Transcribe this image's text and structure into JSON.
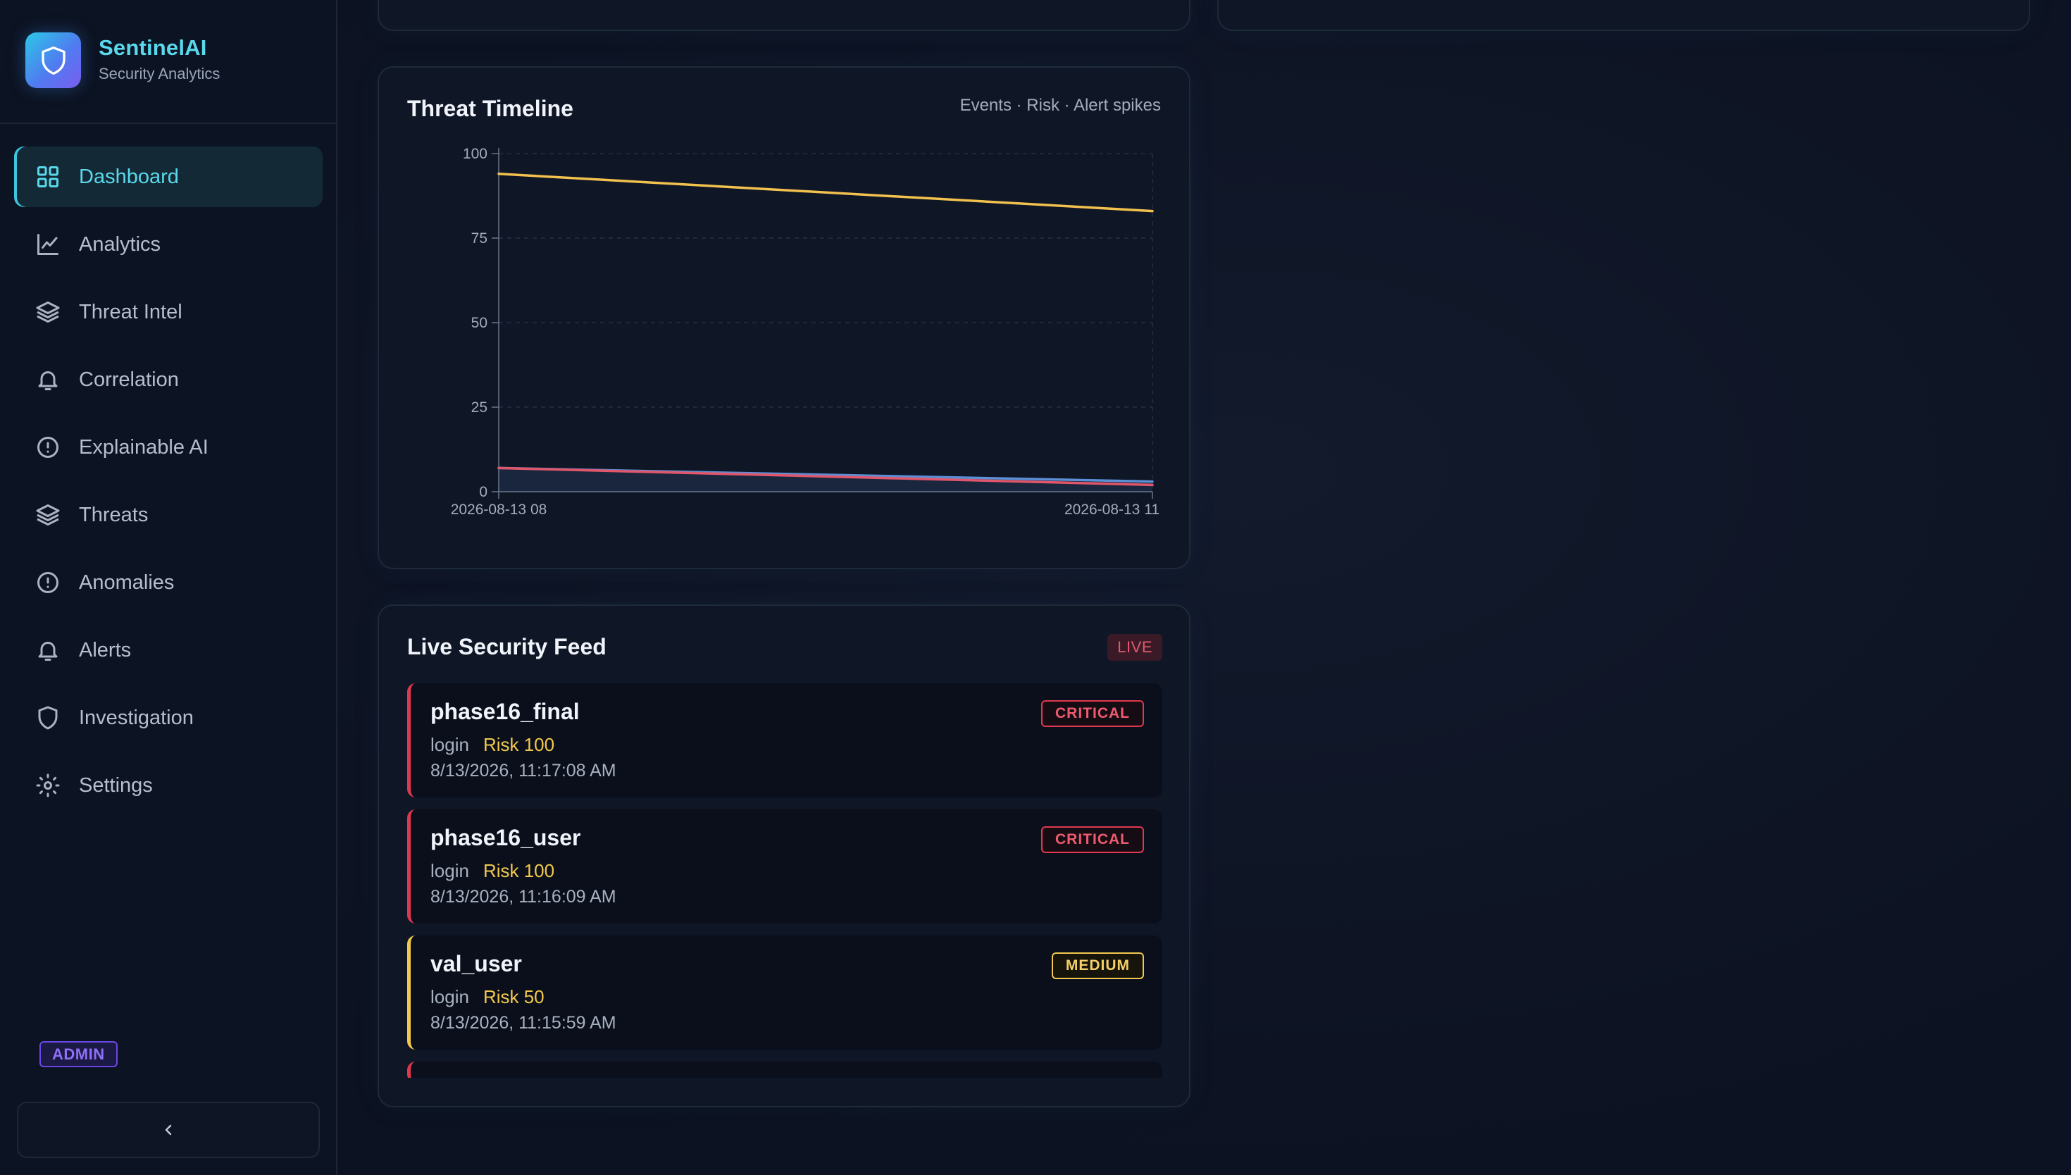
{
  "brand": {
    "name": "SentinelAI",
    "subtitle": "Security Analytics"
  },
  "nav": [
    {
      "label": "Dashboard",
      "icon": "grid-icon",
      "active": true
    },
    {
      "label": "Analytics",
      "icon": "line-chart-icon"
    },
    {
      "label": "Threat Intel",
      "icon": "layers-icon"
    },
    {
      "label": "Correlation",
      "icon": "bell-icon"
    },
    {
      "label": "Explainable AI",
      "icon": "alert-circle-icon"
    },
    {
      "label": "Threats",
      "icon": "layers-icon"
    },
    {
      "label": "Anomalies",
      "icon": "alert-circle-icon"
    },
    {
      "label": "Alerts",
      "icon": "bell-icon"
    },
    {
      "label": "Investigation",
      "icon": "shield-icon"
    },
    {
      "label": "Settings",
      "icon": "gear-icon"
    }
  ],
  "role_badge": "ADMIN",
  "collapse_icon": "chevron-left-icon",
  "timeline": {
    "title": "Threat Timeline",
    "legend": "Events · Risk · Alert spikes"
  },
  "chart_data": {
    "type": "line",
    "x": [
      "2026-08-13 08",
      "2026-08-13 11"
    ],
    "series": [
      {
        "values": [
          94,
          83
        ],
        "color": "#f2c14e"
      },
      {
        "values": [
          7,
          3
        ],
        "color": "#5b8fd6"
      },
      {
        "values": [
          7,
          2
        ],
        "color": "#e0566a"
      }
    ],
    "ylim": [
      0,
      100
    ],
    "yticks": [
      0,
      25,
      50,
      75,
      100
    ],
    "grid": true
  },
  "feed": {
    "title": "Live Security Feed",
    "live_label": "LIVE",
    "items": [
      {
        "user": "phase16_final",
        "action": "login",
        "risk": "Risk 100",
        "time": "8/13/2026, 11:17:08 AM",
        "severity": "CRITICAL",
        "level": "critical"
      },
      {
        "user": "phase16_user",
        "action": "login",
        "risk": "Risk 100",
        "time": "8/13/2026, 11:16:09 AM",
        "severity": "CRITICAL",
        "level": "critical"
      },
      {
        "user": "val_user",
        "action": "login",
        "risk": "Risk 50",
        "time": "8/13/2026, 11:15:59 AM",
        "severity": "MEDIUM",
        "level": "medium"
      }
    ]
  }
}
